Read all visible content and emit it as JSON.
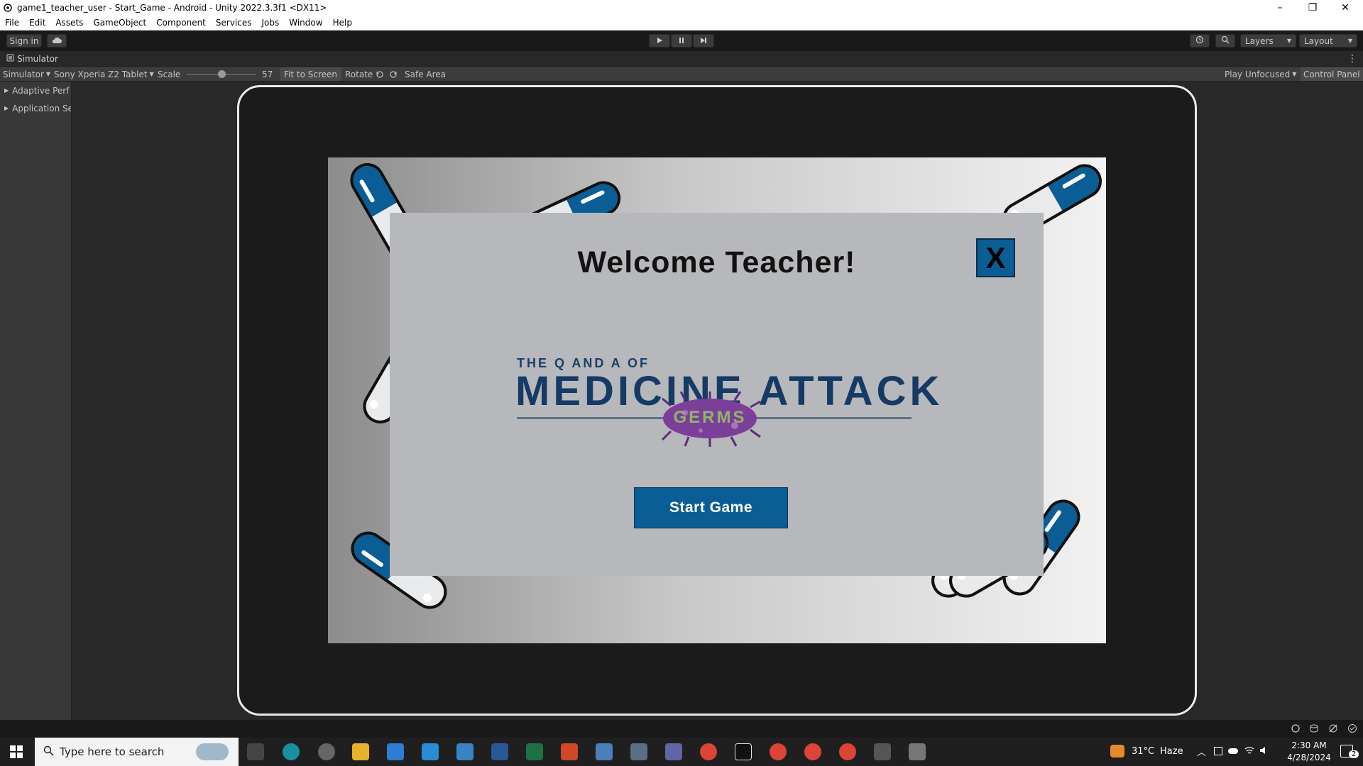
{
  "window": {
    "title": "game1_teacher_user - Start_Game - Android - Unity 2022.3.3f1 <DX11>",
    "minimize": "–",
    "restore": "❐",
    "close": "✕"
  },
  "menu": [
    "File",
    "Edit",
    "Assets",
    "GameObject",
    "Component",
    "Services",
    "Jobs",
    "Window",
    "Help"
  ],
  "toolbar": {
    "sign_in": "Sign in",
    "layers": "Layers",
    "layout": "Layout"
  },
  "tab": {
    "label": "Simulator"
  },
  "simbar": {
    "mode": "Simulator",
    "device": "Sony Xperia Z2 Tablet",
    "scale_label": "Scale",
    "scale_value": "57",
    "fit": "Fit to Screen",
    "rotate": "Rotate",
    "safe_area": "Safe Area",
    "play_mode": "Play Unfocused",
    "control_panel": "Control Panel"
  },
  "left_panel": {
    "items": [
      "Adaptive Perf",
      "Application Se"
    ]
  },
  "game": {
    "welcome": "Welcome Teacher!",
    "close_label": "X",
    "logo_top": "THE Q AND A OF",
    "logo_main": "MEDICINE ATTACK",
    "logo_germs": "GERMS",
    "start_button": "Start Game",
    "button_color": "#0b5d95"
  },
  "taskbar": {
    "search_placeholder": "Type here to search",
    "weather_temp": "31°C",
    "weather_text": "Haze",
    "time": "2:30 AM",
    "date": "4/28/2024",
    "notif_count": "2"
  }
}
